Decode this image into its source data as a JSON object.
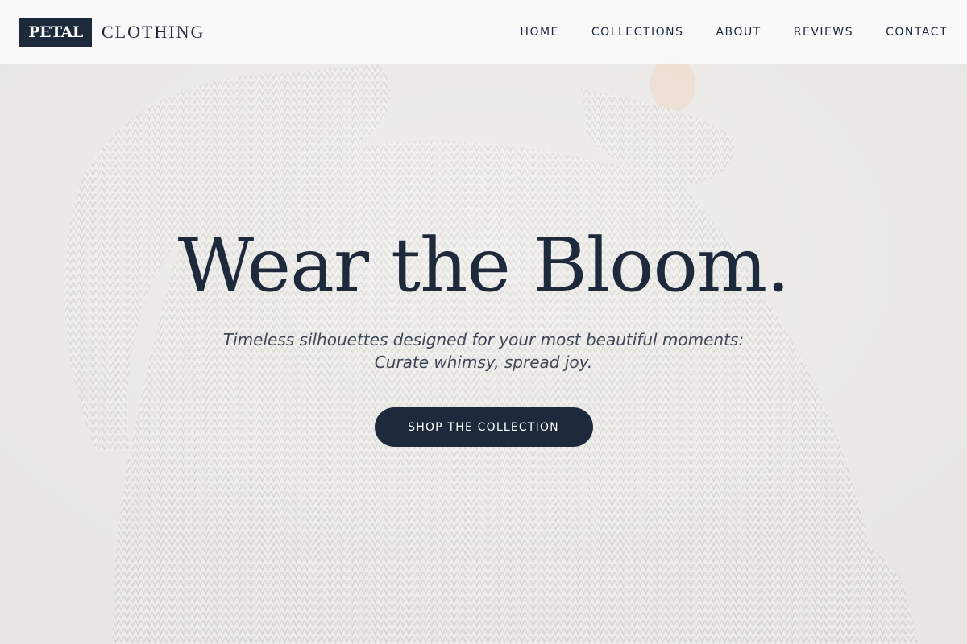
{
  "colors": {
    "primary": "#1e2a3c",
    "header_bg": "#fafafa",
    "hero_bg": "#e6e5e3"
  },
  "brand": {
    "mark": "PETAL",
    "word": "CLOTHING"
  },
  "nav": {
    "items": [
      {
        "label": "HOME"
      },
      {
        "label": "COLLECTIONS"
      },
      {
        "label": "ABOUT"
      },
      {
        "label": "REVIEWS"
      },
      {
        "label": "CONTACT"
      }
    ]
  },
  "hero": {
    "title": "Wear the Bloom.",
    "subtitle_line1": "Timeless silhouettes designed for your most beautiful moments:",
    "subtitle_line2": "Curate whimsy, spread joy.",
    "cta_label": "SHOP THE COLLECTION",
    "image_subject": "person in oversized white knit sweater"
  }
}
